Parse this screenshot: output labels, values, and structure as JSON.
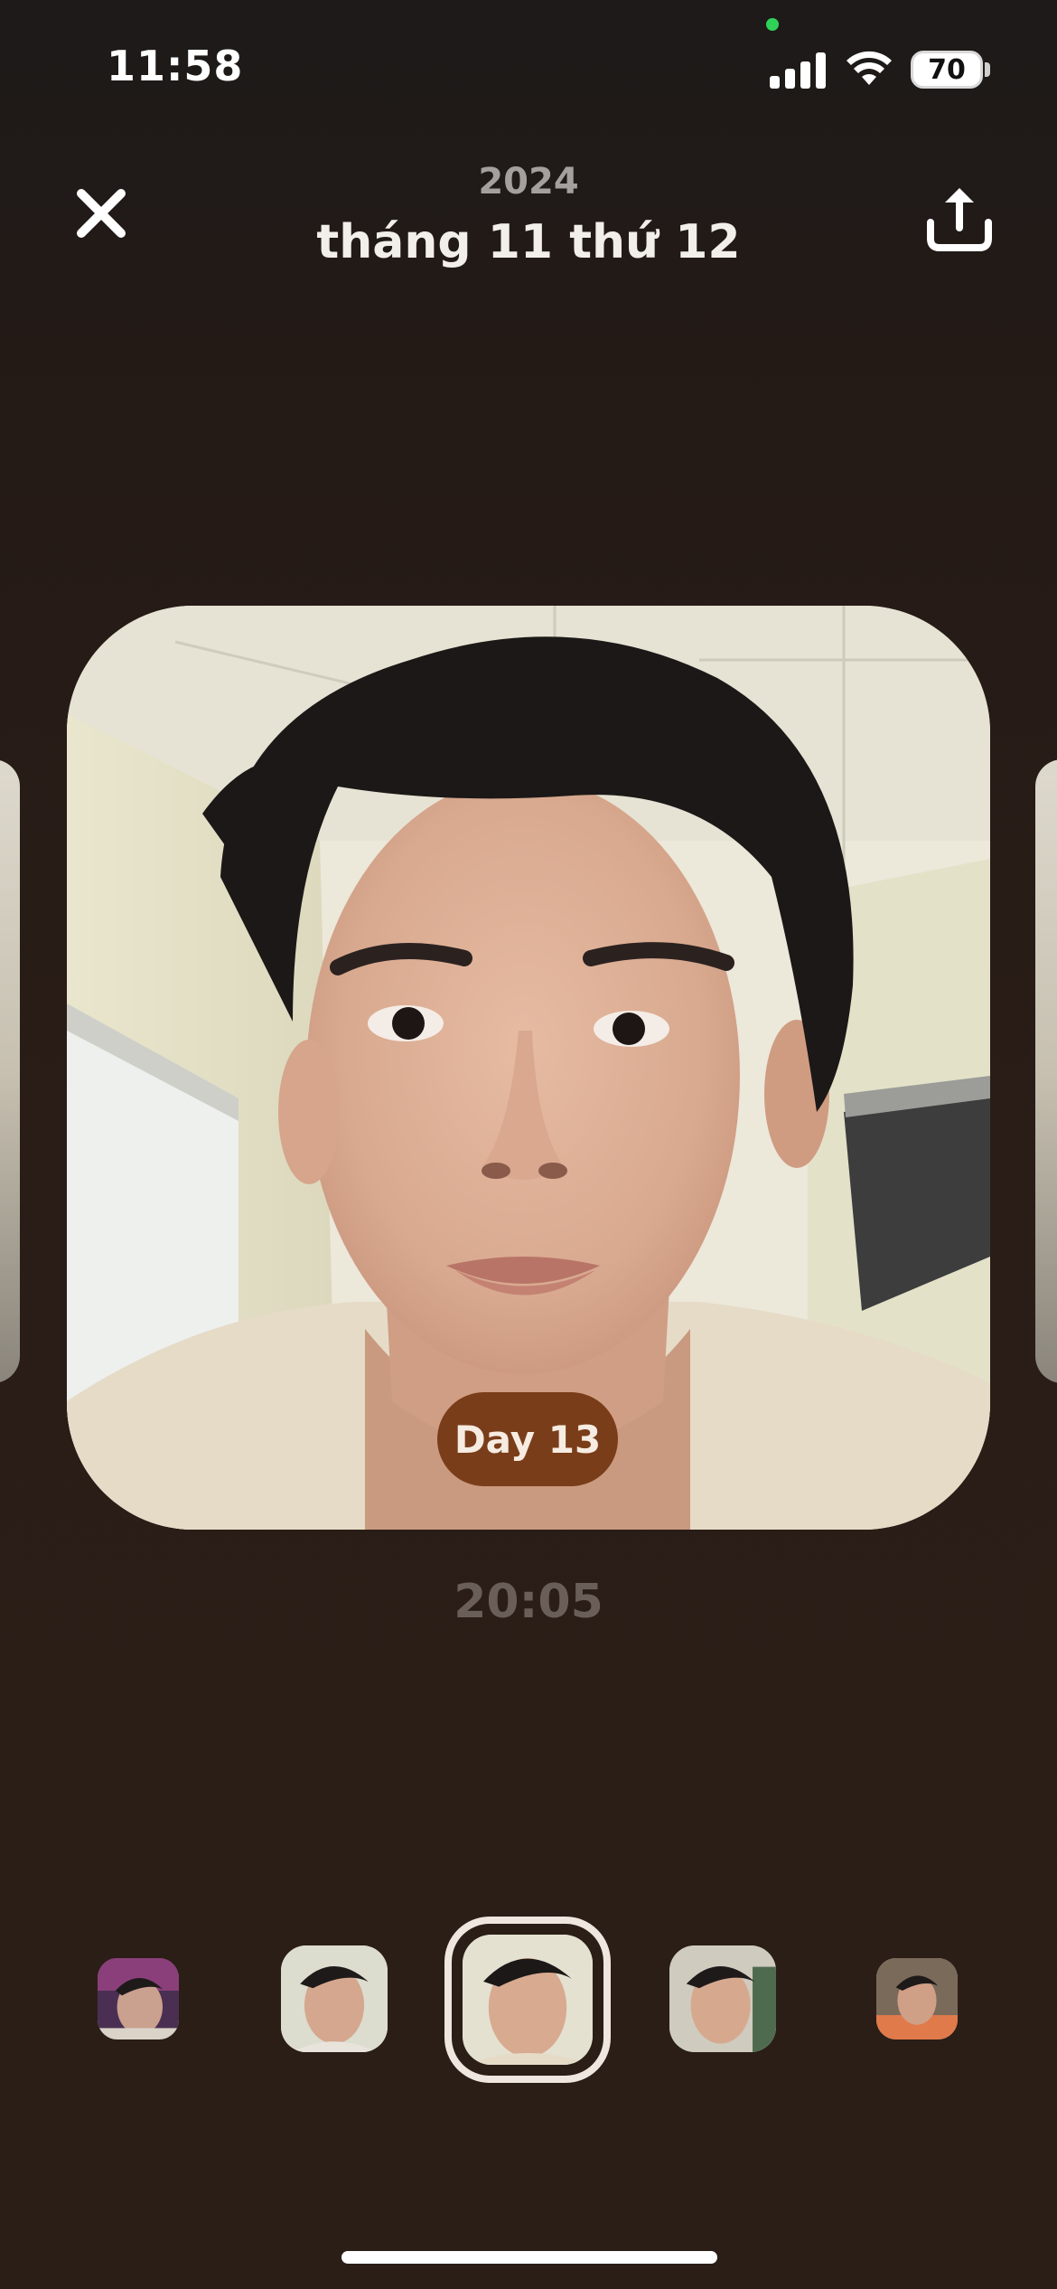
{
  "status_bar": {
    "time": "11:58",
    "battery": "70"
  },
  "header": {
    "year": "2024",
    "title": "tháng 11 thứ 12",
    "close_icon": "close-icon",
    "share_icon": "share-icon"
  },
  "photo": {
    "day_badge": "Day 13",
    "time": "20:05"
  },
  "thumbnails": [
    {
      "name": "thumbnail-1",
      "selected": false
    },
    {
      "name": "thumbnail-2",
      "selected": false
    },
    {
      "name": "thumbnail-3",
      "selected": true
    },
    {
      "name": "thumbnail-4",
      "selected": false
    },
    {
      "name": "thumbnail-5",
      "selected": false
    }
  ],
  "colors": {
    "background": "#2a1d17",
    "badge": "#7a3d1a",
    "privacy_indicator": "#30d158"
  }
}
